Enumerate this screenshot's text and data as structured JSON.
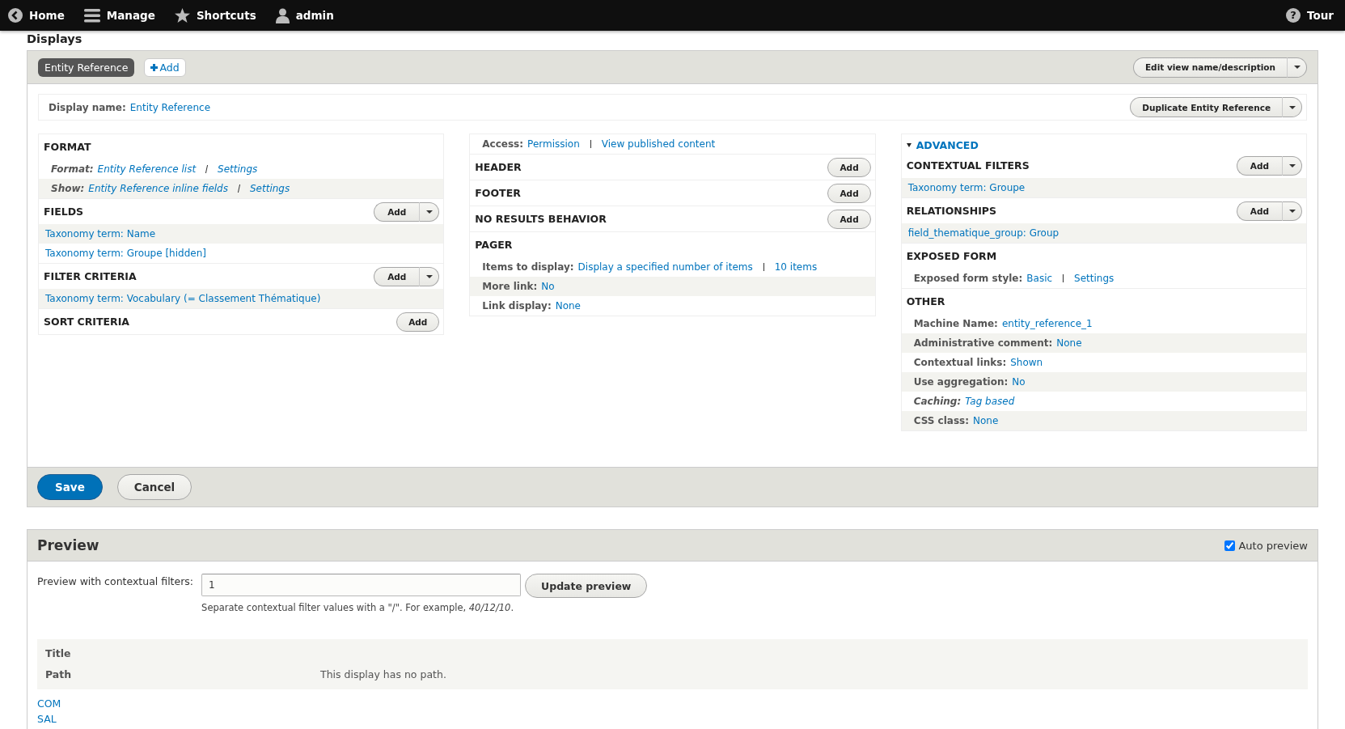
{
  "toolbar": {
    "items": [
      {
        "label": "Home"
      },
      {
        "label": "Manage"
      },
      {
        "label": "Shortcuts"
      },
      {
        "label": "admin"
      }
    ],
    "tour": {
      "label": "Tour",
      "icon": "?"
    }
  },
  "displays": {
    "heading": "Displays",
    "tabs": [
      {
        "label": "Entity Reference",
        "selected": true
      }
    ],
    "add_button": "Add",
    "edit_button": "Edit view name/description"
  },
  "display_name": {
    "label": "Display name:",
    "value": "Entity Reference",
    "duplicate_button": "Duplicate Entity Reference"
  },
  "columns": [
    {
      "sections": [
        {
          "title": "FORMAT",
          "rows": [
            {
              "label": "Format:",
              "italic": true,
              "links": [
                "Entity Reference list",
                "Settings"
              ]
            },
            {
              "label": "Show:",
              "italic": true,
              "links": [
                "Entity Reference inline fields",
                "Settings"
              ]
            }
          ]
        },
        {
          "title": "FIELDS",
          "button": {
            "kind": "split",
            "label": "Add"
          },
          "rows": [
            {
              "links": [
                "Taxonomy term: Name"
              ]
            },
            {
              "links": [
                "Taxonomy term: Groupe [hidden]"
              ]
            }
          ]
        },
        {
          "title": "FILTER CRITERIA",
          "button": {
            "kind": "split",
            "label": "Add"
          },
          "rows": [
            {
              "links": [
                "Taxonomy term: Vocabulary (= Classement Thématique)"
              ]
            }
          ]
        },
        {
          "title": "SORT CRITERIA",
          "button": {
            "kind": "plain",
            "label": "Add"
          }
        }
      ]
    },
    {
      "sections": [
        {
          "rows": [
            {
              "label": "Access:",
              "links": [
                "Permission",
                "View published content"
              ]
            }
          ]
        },
        {
          "title": "HEADER",
          "button": {
            "kind": "plain",
            "label": "Add"
          }
        },
        {
          "title": "FOOTER",
          "button": {
            "kind": "plain",
            "label": "Add"
          }
        },
        {
          "title": "NO RESULTS BEHAVIOR",
          "button": {
            "kind": "plain",
            "label": "Add"
          }
        },
        {
          "title": "PAGER",
          "rows": [
            {
              "label": "Items to display:",
              "links": [
                "Display a specified number of items",
                "10 items"
              ]
            },
            {
              "label": "More link:",
              "links": [
                "No"
              ]
            },
            {
              "label": "Link display:",
              "links": [
                "None"
              ]
            }
          ]
        }
      ]
    },
    {
      "toggle": {
        "label": "ADVANCED",
        "expanded": true
      },
      "sections": [
        {
          "title": "CONTEXTUAL FILTERS",
          "button": {
            "kind": "split",
            "label": "Add"
          },
          "rows": [
            {
              "links": [
                "Taxonomy term: Groupe"
              ]
            }
          ]
        },
        {
          "title": "RELATIONSHIPS",
          "button": {
            "kind": "split",
            "label": "Add"
          },
          "rows": [
            {
              "links": [
                "field_thematique_group: Group"
              ]
            }
          ]
        },
        {
          "title": "EXPOSED FORM",
          "rows": [
            {
              "label": "Exposed form style:",
              "links": [
                "Basic",
                "Settings"
              ]
            }
          ]
        },
        {
          "title": "OTHER",
          "rows": [
            {
              "label": "Machine Name:",
              "links": [
                "entity_reference_1"
              ]
            },
            {
              "label": "Administrative comment:",
              "links": [
                "None"
              ]
            },
            {
              "label": "Contextual links:",
              "links": [
                "Shown"
              ]
            },
            {
              "label": "Use aggregation:",
              "links": [
                "No"
              ]
            },
            {
              "label": "Caching:",
              "italic": true,
              "links": [
                "Tag based"
              ]
            },
            {
              "label": "CSS class:",
              "links": [
                "None"
              ]
            }
          ]
        }
      ]
    }
  ],
  "actions": {
    "save": "Save",
    "cancel": "Cancel"
  },
  "preview": {
    "title": "Preview",
    "auto_preview": {
      "label": "Auto preview",
      "checked": true
    },
    "filter_label": "Preview with contextual filters:",
    "filter_value": "1",
    "update_button": "Update preview",
    "description": "Separate contextual filter values with a \"/\". For example, *40/12/10*.",
    "info": [
      {
        "label": "Title"
      },
      {
        "label": "Path",
        "value": "This display has no path."
      }
    ],
    "results": [
      "COM",
      "SAL"
    ]
  }
}
